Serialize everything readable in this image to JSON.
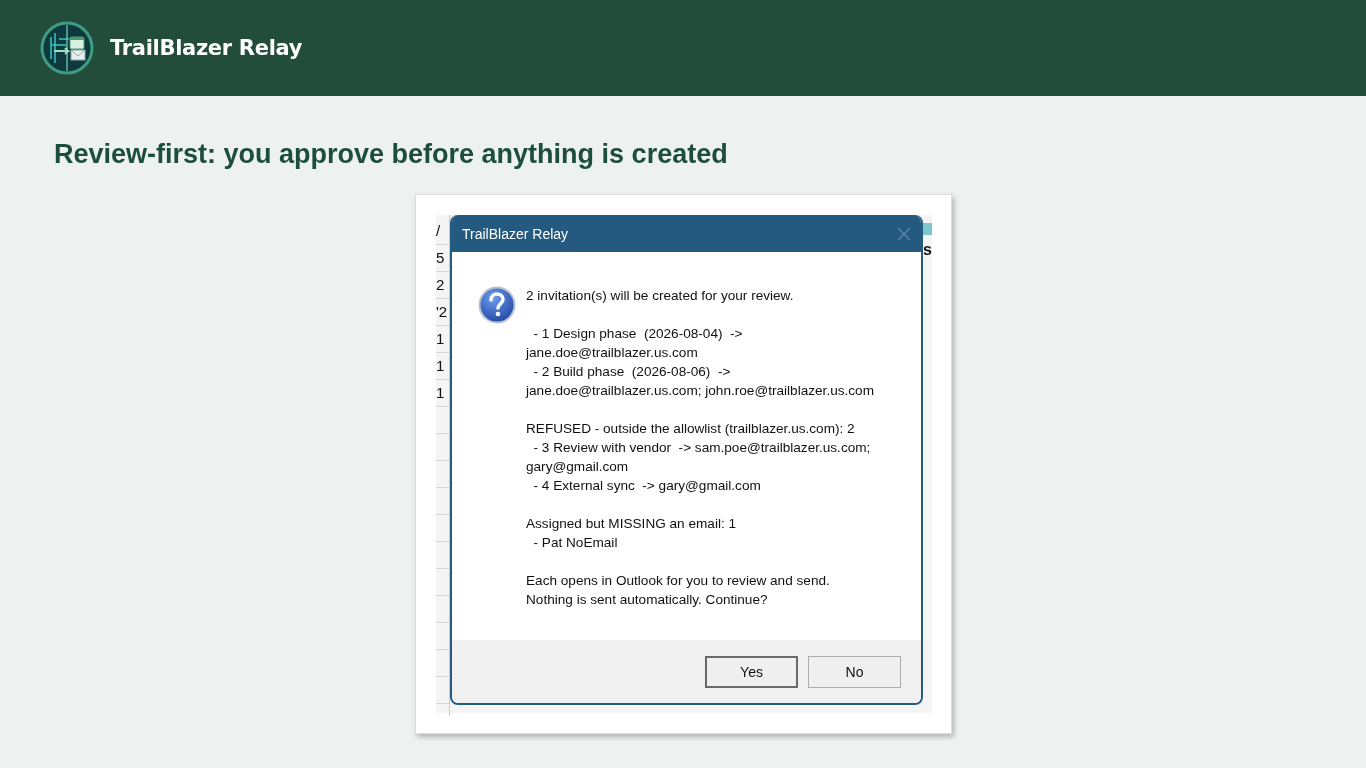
{
  "header": {
    "app_name": "TrailBlazer Relay"
  },
  "heading": "Review-first: you approve before anything is created",
  "background_sheet": {
    "left_cells": [
      "/",
      "5",
      "2",
      "'2",
      "1",
      "1",
      "1"
    ],
    "right_cell": "s"
  },
  "dialog": {
    "title": "TrailBlazer Relay",
    "message_blocks": [
      [
        "2 invitation(s) will be created for your review."
      ],
      [
        "  - 1 Design phase  (2026-08-04)  ->",
        "jane.doe@trailblazer.us.com",
        "  - 2 Build phase  (2026-08-06)  ->",
        "jane.doe@trailblazer.us.com; john.roe@trailblazer.us.com"
      ],
      [
        "REFUSED - outside the allowlist (trailblazer.us.com): 2",
        "  - 3 Review with vendor  -> sam.poe@trailblazer.us.com;",
        "gary@gmail.com",
        "  - 4 External sync  -> gary@gmail.com"
      ],
      [
        "Assigned but MISSING an email: 1",
        "  - Pat NoEmail"
      ],
      [
        "Each opens in Outlook for you to review and send.",
        "Nothing is sent automatically. Continue?"
      ]
    ],
    "buttons": [
      {
        "label": "Yes",
        "default": true
      },
      {
        "label": "No",
        "default": false
      }
    ]
  }
}
